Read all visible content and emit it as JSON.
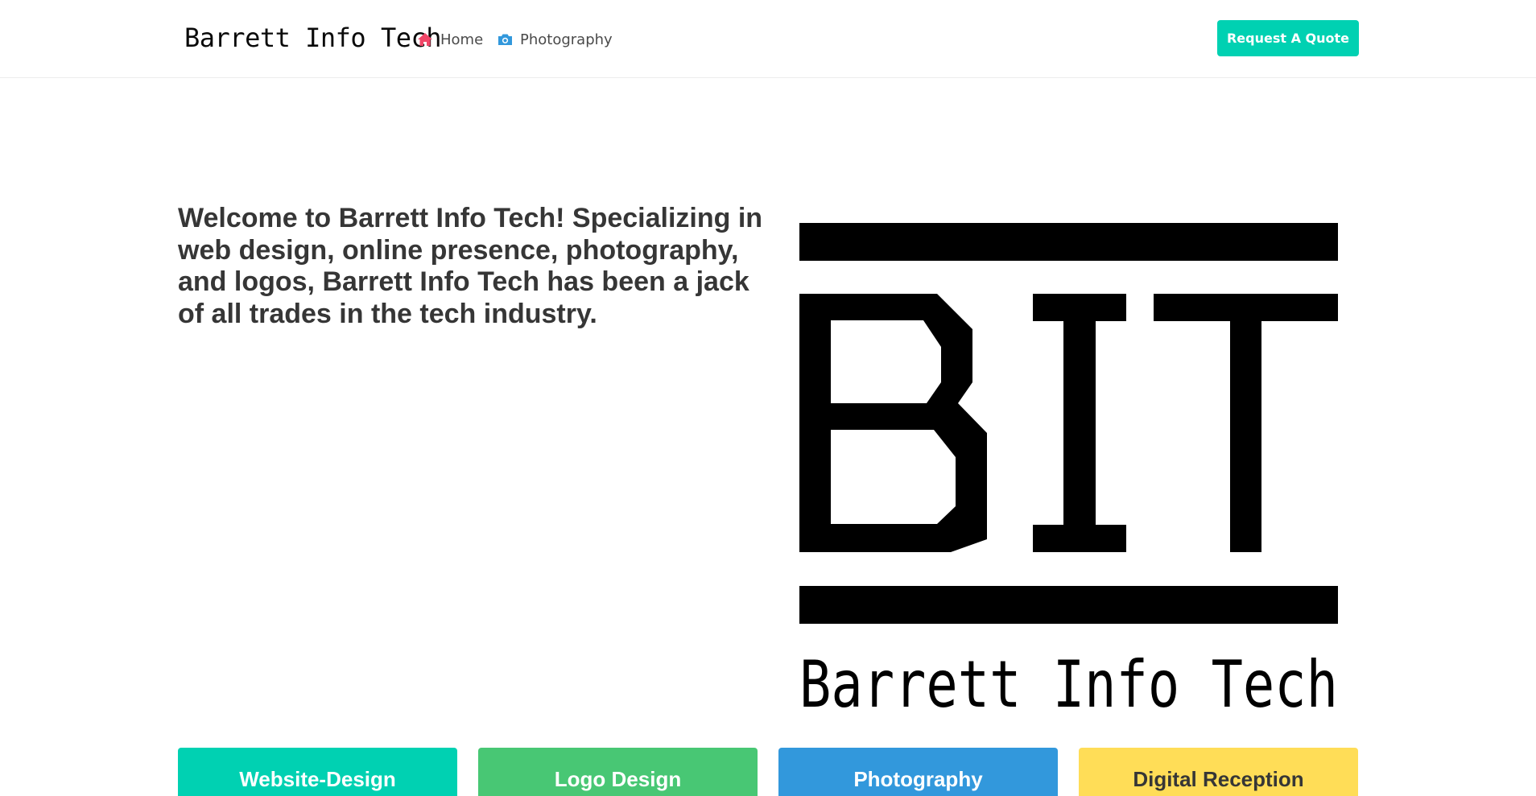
{
  "navbar": {
    "brand": "Barrett Info Tech",
    "items": [
      {
        "label": "Home",
        "icon": "home-icon",
        "icon_color": "#f14668"
      },
      {
        "label": "Photography",
        "icon": "camera-icon",
        "icon_color": "#3298dc"
      }
    ],
    "quote_button": "Request A Quote"
  },
  "intro": {
    "text": "Welcome to Barrett Info Tech! Specializing in web design, online presence, photography, and logos, Barrett Info Tech has been a jack of all trades in the tech industry."
  },
  "logo": {
    "letters": "BIT",
    "wordmark": "Barrett Info Tech"
  },
  "services": [
    {
      "label": "Website-Design",
      "color": "#00d1b2"
    },
    {
      "label": "Logo Design",
      "color": "#48c774"
    },
    {
      "label": "Photography",
      "color": "#3298dc"
    },
    {
      "label": "Digital Reception",
      "color": "#ffdd57"
    }
  ],
  "colors": {
    "primary": "#00d1b2",
    "success": "#48c774",
    "info": "#3298dc",
    "warning": "#ffdd57",
    "danger": "#f14668",
    "text": "#363636"
  }
}
